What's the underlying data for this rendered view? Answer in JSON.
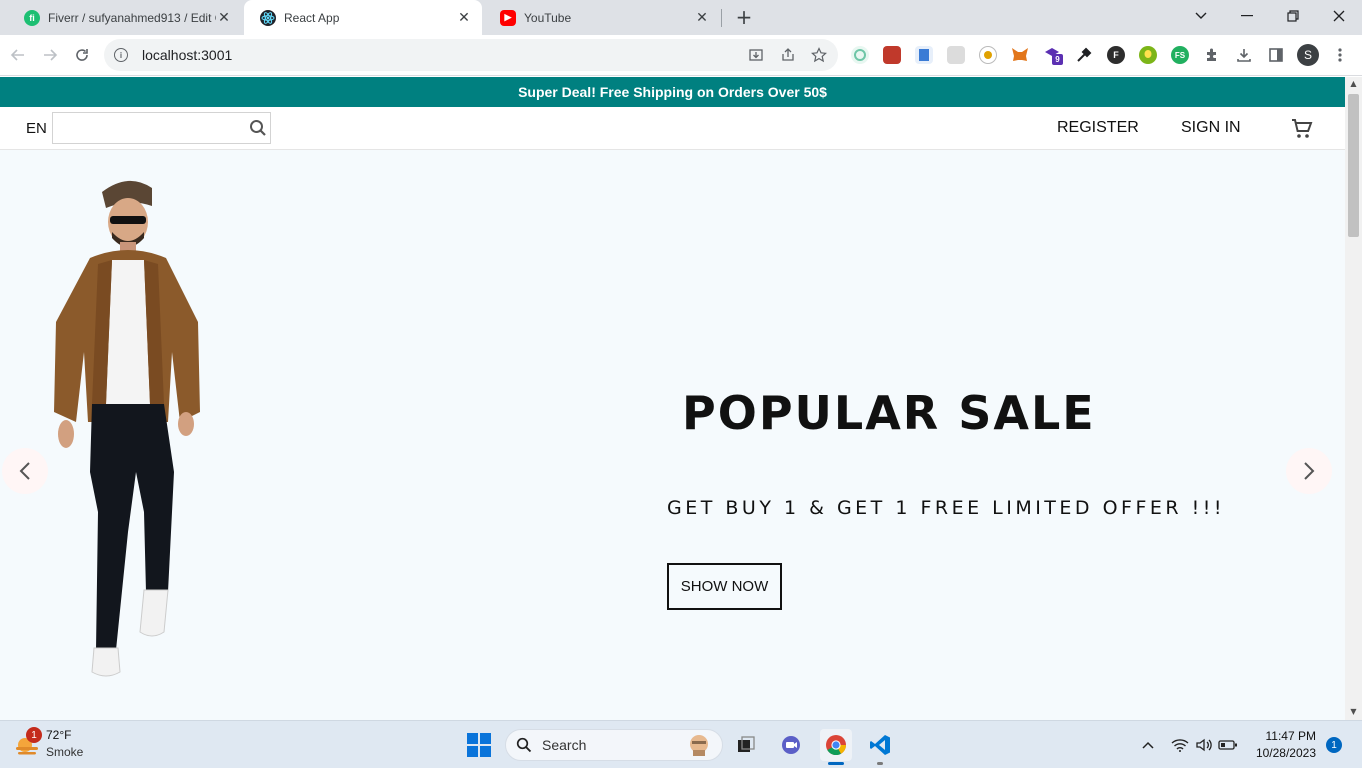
{
  "browser": {
    "tabs": [
      {
        "title": "Fiverr / sufyanahmed913 / Edit G",
        "favicon": "fiverr-icon",
        "color": "#1dbf73"
      },
      {
        "title": "React App",
        "favicon": "react-icon",
        "color": "#61dafb"
      },
      {
        "title": "YouTube",
        "favicon": "youtube-icon",
        "color": "#ff0000"
      }
    ],
    "url": "localhost:3001",
    "profile_initial": "S",
    "extensions": [
      {
        "name": "extension-1-icon",
        "color": "#6ec6a7"
      },
      {
        "name": "extension-2-icon",
        "color": "#c0392b"
      },
      {
        "name": "extension-3-icon",
        "color": "#3a7bd5"
      },
      {
        "name": "extension-4-icon",
        "color": "#9e9e9e"
      },
      {
        "name": "extension-5-icon",
        "color": "#e0a100"
      },
      {
        "name": "metamask-icon",
        "color": "#e2761b"
      },
      {
        "name": "extension-7-icon",
        "color": "#5b2fb2",
        "badge": "9"
      },
      {
        "name": "eyedropper-icon",
        "color": "#202124"
      },
      {
        "name": "extension-9-icon",
        "color": "#2d2d2d",
        "label": "F"
      },
      {
        "name": "extension-10-icon",
        "color": "#7cb518"
      },
      {
        "name": "extension-11-icon",
        "color": "#21b060",
        "label": "FS"
      }
    ]
  },
  "page": {
    "announcement": "Super Deal! Free Shipping on Orders Over 50$",
    "navbar": {
      "language": "EN",
      "search_placeholder": "",
      "register": "REGISTER",
      "sign_in": "SIGN IN"
    },
    "hero": {
      "title": "POPULAR SALE",
      "subtitle": "GET BUY 1 & GET 1 FREE LIMITED OFFER !!!",
      "button": "SHOW NOW",
      "background": "#f5fafd"
    },
    "accent_color": "#008080"
  },
  "taskbar": {
    "weather": {
      "temp": "72°F",
      "condition": "Smoke",
      "badge": "1"
    },
    "search_label": "Search",
    "clock": {
      "time": "11:47 PM",
      "date": "10/28/2023"
    },
    "notifications": "1"
  }
}
